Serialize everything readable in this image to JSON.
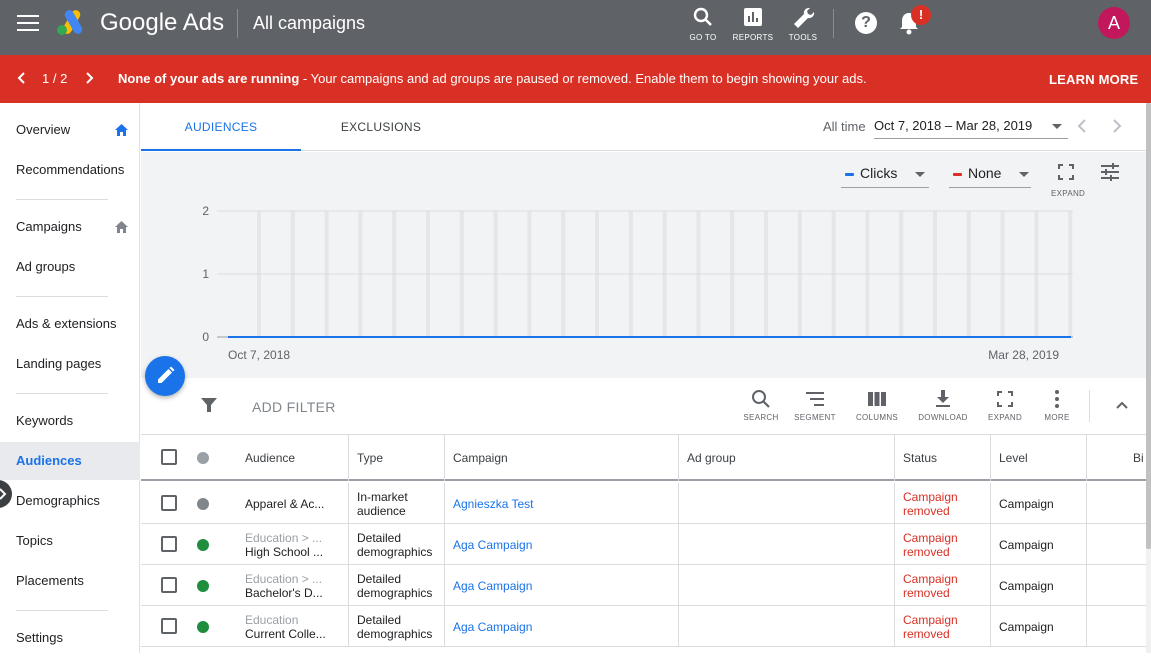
{
  "topbar": {
    "brand": "Google Ads",
    "page_title": "All campaigns",
    "tools": [
      {
        "label": "GO TO",
        "icon": "search-icon"
      },
      {
        "label": "REPORTS",
        "icon": "reports-icon"
      },
      {
        "label": "TOOLS",
        "icon": "wrench-icon"
      }
    ],
    "notification_badge": "!",
    "avatar_letter": "A"
  },
  "banner": {
    "pager": "1 / 2",
    "message_bold": "None of your ads are running",
    "message_rest": " - Your campaigns and ad groups are paused or removed. Enable them to begin showing your ads.",
    "action": "LEARN MORE"
  },
  "sidebar": {
    "items": [
      {
        "label": "Overview"
      },
      {
        "label": "Recommendations"
      },
      {
        "label": "Campaigns"
      },
      {
        "label": "Ad groups"
      },
      {
        "label": "Ads & extensions"
      },
      {
        "label": "Landing pages"
      },
      {
        "label": "Keywords"
      },
      {
        "label": "Audiences"
      },
      {
        "label": "Demographics"
      },
      {
        "label": "Topics"
      },
      {
        "label": "Placements"
      },
      {
        "label": "Settings"
      }
    ]
  },
  "tabs": [
    {
      "label": "AUDIENCES"
    },
    {
      "label": "EXCLUSIONS"
    }
  ],
  "date": {
    "label": "All time",
    "range": "Oct 7, 2018 – Mar 28, 2019"
  },
  "chart_controls": {
    "metric1": "Clicks",
    "metric1_color": "#1a73e8",
    "metric2": "None",
    "metric2_color": "#d93025",
    "expand_label": "EXPAND"
  },
  "chart_data": {
    "type": "line",
    "title": "",
    "xlabel": "",
    "ylabel": "",
    "ylim": [
      0,
      2
    ],
    "yticks": [
      "2",
      "1",
      "0"
    ],
    "x_start_label": "Oct 7, 2018",
    "x_end_label": "Mar 28, 2019",
    "grid": true,
    "series": [
      {
        "name": "Clicks",
        "color": "#1a73e8",
        "values": [
          0,
          0
        ]
      }
    ]
  },
  "toolbar": {
    "add_filter": "ADD FILTER",
    "buttons": [
      {
        "label": "SEARCH",
        "icon": "search-icon"
      },
      {
        "label": "SEGMENT",
        "icon": "segment-icon"
      },
      {
        "label": "COLUMNS",
        "icon": "columns-icon"
      },
      {
        "label": "DOWNLOAD",
        "icon": "download-icon"
      },
      {
        "label": "EXPAND",
        "icon": "expand-icon"
      },
      {
        "label": "MORE",
        "icon": "more-vert-icon"
      }
    ]
  },
  "table": {
    "headers": [
      "Audience",
      "Type",
      "Campaign",
      "Ad group",
      "Status",
      "Level",
      "Bi"
    ],
    "rows": [
      {
        "status_dot": "#80868b",
        "audience_top": "",
        "audience": "Apparel & Ac...",
        "type": "In-market audience",
        "campaign": "Agnieszka Test",
        "ad_group": "",
        "status": "Campaign removed",
        "level": "Campaign"
      },
      {
        "status_dot": "#1e8e3e",
        "audience_top": "Education > ...",
        "audience": "High School ...",
        "type": "Detailed demographics",
        "campaign": "Aga Campaign",
        "ad_group": "",
        "status": "Campaign removed",
        "level": "Campaign"
      },
      {
        "status_dot": "#1e8e3e",
        "audience_top": "Education > ...",
        "audience": "Bachelor's D...",
        "type": "Detailed demographics",
        "campaign": "Aga Campaign",
        "ad_group": "",
        "status": "Campaign removed",
        "level": "Campaign"
      },
      {
        "status_dot": "#1e8e3e",
        "audience_top": "Education",
        "audience": "Current Colle...",
        "type": "Detailed demographics",
        "campaign": "Aga Campaign",
        "ad_group": "",
        "status": "Campaign removed",
        "level": "Campaign"
      }
    ]
  }
}
